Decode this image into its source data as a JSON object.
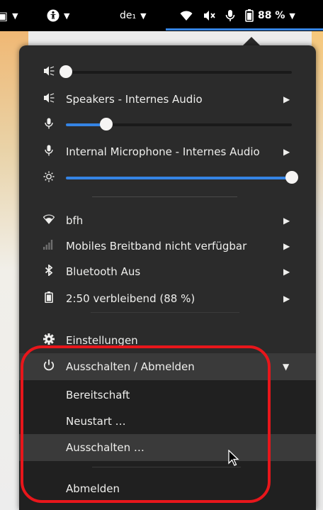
{
  "topbar": {
    "window_glyph": "▣",
    "accessibility_icon": "accessibility-icon",
    "keyboard_layout": "de₁",
    "wifi_icon": "wifi-icon",
    "volume_icon": "volume-muted-icon",
    "mic_icon": "microphone-icon",
    "battery_icon": "battery-icon",
    "battery_percent": "88 %"
  },
  "menu": {
    "speakers_label": "Speakers - Internes Audio",
    "output_volume": 0.0,
    "mic_volume": 0.18,
    "mic_label": "Internal Microphone - Internes Audio",
    "brightness": 1.0,
    "wifi_label": "bfh",
    "mobile_label": "Mobiles Breitband nicht verfügbar",
    "bluetooth_label": "Bluetooth Aus",
    "battery_label": "2:50 verbleibend (88 %)",
    "settings_label": "Einstellungen",
    "power_label": "Ausschalten / Abmelden",
    "power_items": [
      "Bereitschaft",
      "Neustart …",
      "Ausschalten …",
      "Abmelden"
    ]
  },
  "colors": {
    "accent": "#3584e4",
    "panel": "#2b2b2b",
    "annotation": "#e8161b"
  }
}
